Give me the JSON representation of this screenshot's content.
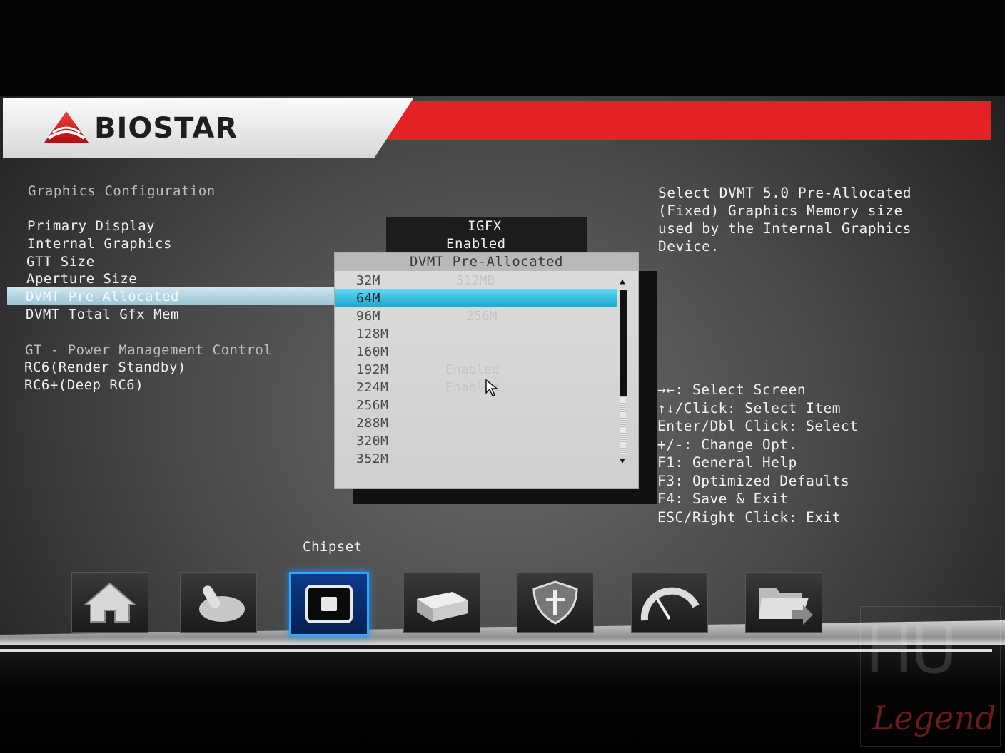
{
  "brand": {
    "name": "BIOSTAR"
  },
  "left_menu": {
    "section_title": "Graphics Configuration",
    "items": [
      {
        "label": "Primary Display",
        "value": "IGFX"
      },
      {
        "label": "Internal Graphics",
        "value": "Enabled"
      },
      {
        "label": "GTT Size",
        "value": ""
      },
      {
        "label": "Aperture Size",
        "value": "512MB"
      },
      {
        "label": "DVMT Pre-Allocated",
        "value": "64M"
      },
      {
        "label": "DVMT Total Gfx Mem",
        "value": "256M"
      }
    ],
    "section2_title": "GT - Power Management Control",
    "items2": [
      {
        "label": "RC6(Render Standby)",
        "value": "Enabled"
      },
      {
        "label": "RC6+(Deep RC6)",
        "value": "Enabled"
      }
    ]
  },
  "popup": {
    "title": "DVMT Pre-Allocated",
    "options": [
      "32M",
      "64M",
      "96M",
      "128M",
      "160M",
      "192M",
      "224M",
      "256M",
      "288M",
      "320M",
      "352M"
    ],
    "selected": "64M"
  },
  "help_text": {
    "lines": [
      "Select DVMT 5.0 Pre-Allocated",
      "(Fixed) Graphics Memory size",
      "used by the Internal Graphics",
      "Device."
    ]
  },
  "key_help": [
    "→←: Select Screen",
    "↑↓/Click: Select Item",
    "Enter/Dbl Click: Select",
    "+/-: Change Opt.",
    "F1: General Help",
    "F3: Optimized Defaults",
    "F4: Save & Exit",
    "ESC/Right Click: Exit"
  ],
  "tabs": {
    "active_label": "Chipset",
    "icons": [
      "home-icon",
      "joystick-icon",
      "chipset-icon",
      "drive-icon",
      "shield-icon",
      "speedometer-icon",
      "folder-exit-icon"
    ]
  },
  "watermark": {
    "text": "Legend"
  },
  "colors": {
    "accent_red": "#e52126",
    "selection_blue": "#1ea8cf",
    "active_tab_border": "#2aa7ff"
  }
}
